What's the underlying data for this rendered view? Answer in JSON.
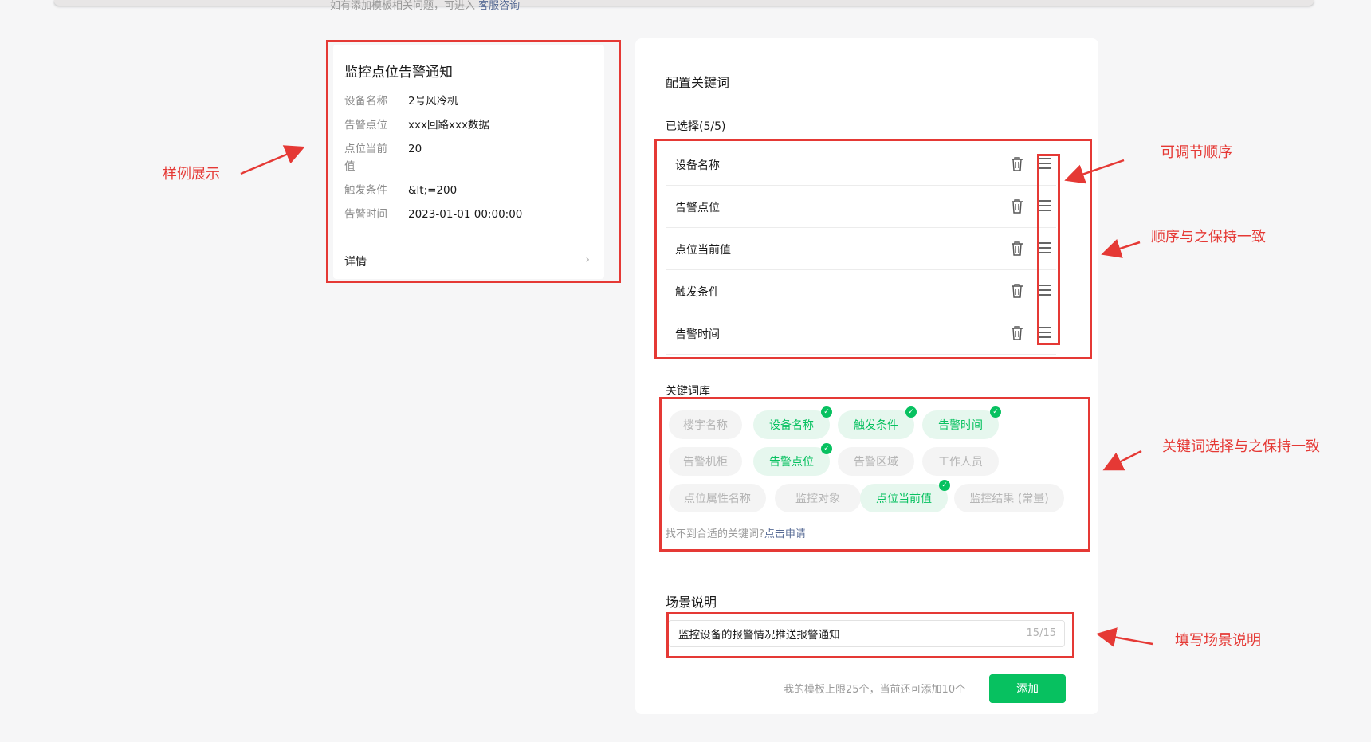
{
  "top_hint": {
    "text": "如有添加模板相关问题，可进入",
    "link": "客服咨询"
  },
  "preview": {
    "title": "监控点位告警通知",
    "rows": [
      {
        "key": "设备名称",
        "value": "2号风冷机"
      },
      {
        "key": "告警点位",
        "value": "xxx回路xxx数据"
      },
      {
        "key": "点位当前值",
        "value": "20"
      },
      {
        "key": "触发条件",
        "value": "&lt;=200"
      },
      {
        "key": "告警时间",
        "value": "2023-01-01 00:00:00"
      }
    ],
    "detail": "详情",
    "chevron": "›"
  },
  "config": {
    "title": "配置关键词",
    "selected_label": "已选择(5/5)",
    "selected": [
      "设备名称",
      "告警点位",
      "点位当前值",
      "触发条件",
      "告警时间"
    ],
    "library_label": "关键词库",
    "library": [
      {
        "label": "楼宇名称",
        "selected": false
      },
      {
        "label": "设备名称",
        "selected": true
      },
      {
        "label": "触发条件",
        "selected": true
      },
      {
        "label": "告警时间",
        "selected": true
      },
      {
        "label": "告警机柜",
        "selected": false
      },
      {
        "label": "告警点位",
        "selected": true
      },
      {
        "label": "告警区域",
        "selected": false
      },
      {
        "label": "工作人员",
        "selected": false
      },
      {
        "label": "点位属性名称",
        "selected": false
      },
      {
        "label": "监控对象",
        "selected": false
      },
      {
        "label": "点位当前值",
        "selected": true
      },
      {
        "label": "监控结果 (常量)",
        "selected": false
      }
    ],
    "library_hint": "找不到合适的关键词?",
    "library_hint_link": "点击申请",
    "scene_label": "场景说明",
    "scene_value": "监控设备的报警情况推送报警通知",
    "scene_count": "15/15",
    "limit_text": "我的模板上限25个，当前还可添加10个",
    "add_label": "添加"
  },
  "annotations": {
    "sample": "样例展示",
    "order": "可调节顺序",
    "keep_order": "顺序与之保持一致",
    "keyword_keep": "关键词选择与之保持一致",
    "scene": "填写场景说明"
  },
  "colors": {
    "accent": "#07c160",
    "annotation": "#e53935",
    "link": "#576b95"
  }
}
